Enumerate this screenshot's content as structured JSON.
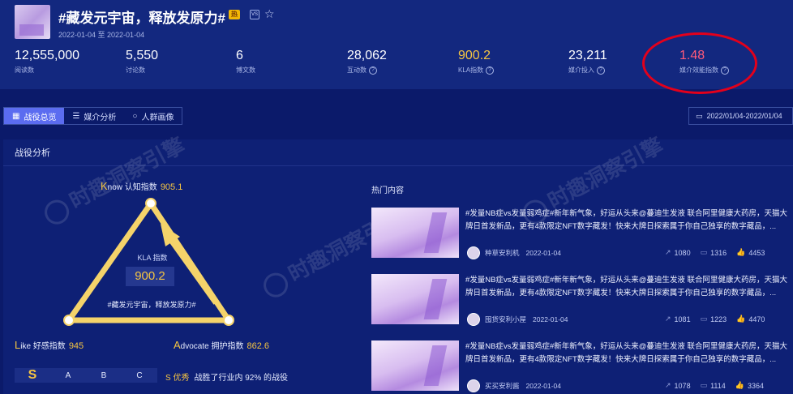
{
  "header": {
    "title": "#藏发元宇宙，释放发原力#",
    "badge_hot": "热",
    "badge_vs": "VS",
    "star_icon": "star-outline-icon",
    "date_range": "2022-01-04 至 2022-01-04"
  },
  "stats": [
    {
      "value": "12,555,000",
      "label": "阅读数",
      "help": false
    },
    {
      "value": "5,550",
      "label": "讨论数",
      "help": false
    },
    {
      "value": "6",
      "label": "博文数",
      "help": false
    },
    {
      "value": "28,062",
      "label": "互动数",
      "help": true
    },
    {
      "value": "900.2",
      "label": "KLA指数",
      "help": true
    },
    {
      "value": "23,211",
      "label": "媒介投入",
      "help": true
    },
    {
      "value": "1.48",
      "label": "媒介效能指数",
      "help": true
    }
  ],
  "tabs": [
    {
      "label": "战役总览",
      "icon": "chart-icon",
      "active": true
    },
    {
      "label": "媒介分析",
      "icon": "sliders-icon",
      "active": false
    },
    {
      "label": "人群画像",
      "icon": "user-icon",
      "active": false
    }
  ],
  "date_picker": {
    "icon": "calendar-icon",
    "value": "2022/01/04-2022/01/04"
  },
  "panel": {
    "title": "战役分析",
    "watermark": "时趣洞察引擎"
  },
  "kla": {
    "know": {
      "letter": "K",
      "rest": "now",
      "cn": "认知指数",
      "value": "905.1"
    },
    "like": {
      "letter": "L",
      "rest": "ike",
      "cn": "好感指数",
      "value": "945"
    },
    "advocate": {
      "letter": "A",
      "rest": "dvocate",
      "cn": "拥护指数",
      "value": "862.6"
    },
    "center_label": "KLA 指数",
    "center_value": "900.2",
    "topic": "#藏发元宇宙，释放发原力#",
    "know_score": 905.1,
    "like_score": 945,
    "advocate_score": 862.6
  },
  "grades": {
    "items": [
      "S",
      "A",
      "B",
      "C"
    ],
    "current": "S",
    "level_text": "S 优秀",
    "desc": "战胜了行业内 92% 的战役"
  },
  "hot": {
    "title": "热门内容",
    "items": [
      {
        "text": "#发量NB症vs发量弱鸡症#新年新气象，好运从头来@蔓迪生发液 联合阿里健康大药房，天猫大牌日首发新品，更有4款限定NFT数字藏发！快来大牌日探索属于你自己独享的数字藏品，...",
        "author": "种草安利机",
        "date": "2022-01-04",
        "shares": "1080",
        "comments": "1316",
        "likes": "4453"
      },
      {
        "text": "#发量NB症vs发量弱鸡症#新年新气象，好运从头来@蔓迪生发液 联合阿里健康大药房，天猫大牌日首发新品，更有4款限定NFT数字藏发！快来大牌日探索属于你自己独享的数字藏品，...",
        "author": "囤货安利小屋",
        "date": "2022-01-04",
        "shares": "1081",
        "comments": "1223",
        "likes": "4470"
      },
      {
        "text": "#发量NB症vs发量弱鸡症#新年新气象，好运从头来@蔓迪生发液 联合阿里健康大药房，天猫大牌日首发新品，更有4款限定NFT数字藏发！快来大牌日探索属于你自己独享的数字藏品，...",
        "author": "买买安利酱",
        "date": "2022-01-04",
        "shares": "1078",
        "comments": "1114",
        "likes": "3364"
      }
    ]
  },
  "colors": {
    "bg": "#0b1a6a",
    "card": "#13287f",
    "accent": "#f5c542",
    "highlight": "#ff5a7a",
    "tab_active": "#5b6cf0",
    "annotation": "#e3001b"
  }
}
